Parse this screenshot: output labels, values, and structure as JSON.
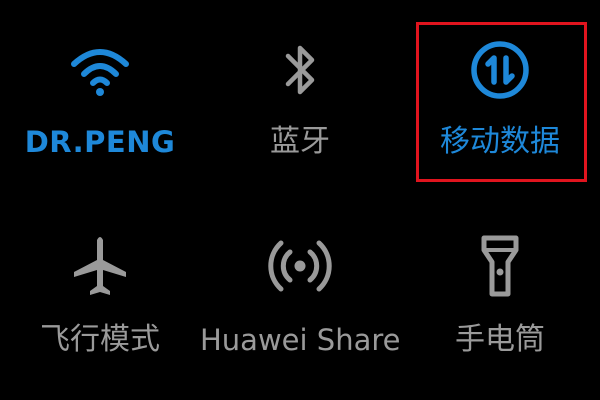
{
  "colors": {
    "background": "#000000",
    "active": "#1e88d9",
    "inactive": "#9a9a9a",
    "highlight": "#e0141e"
  },
  "tiles": [
    {
      "label": "DR.PENG",
      "icon": "wifi-icon",
      "state": "on"
    },
    {
      "label": "蓝牙",
      "icon": "bluetooth-icon",
      "state": "off"
    },
    {
      "label": "移动数据",
      "icon": "mobile-data-icon",
      "state": "on",
      "highlighted": true
    },
    {
      "label": "飞行模式",
      "icon": "airplane-icon",
      "state": "off"
    },
    {
      "label": "Huawei Share",
      "icon": "huawei-share-icon",
      "state": "off"
    },
    {
      "label": "手电筒",
      "icon": "flashlight-icon",
      "state": "off"
    }
  ]
}
